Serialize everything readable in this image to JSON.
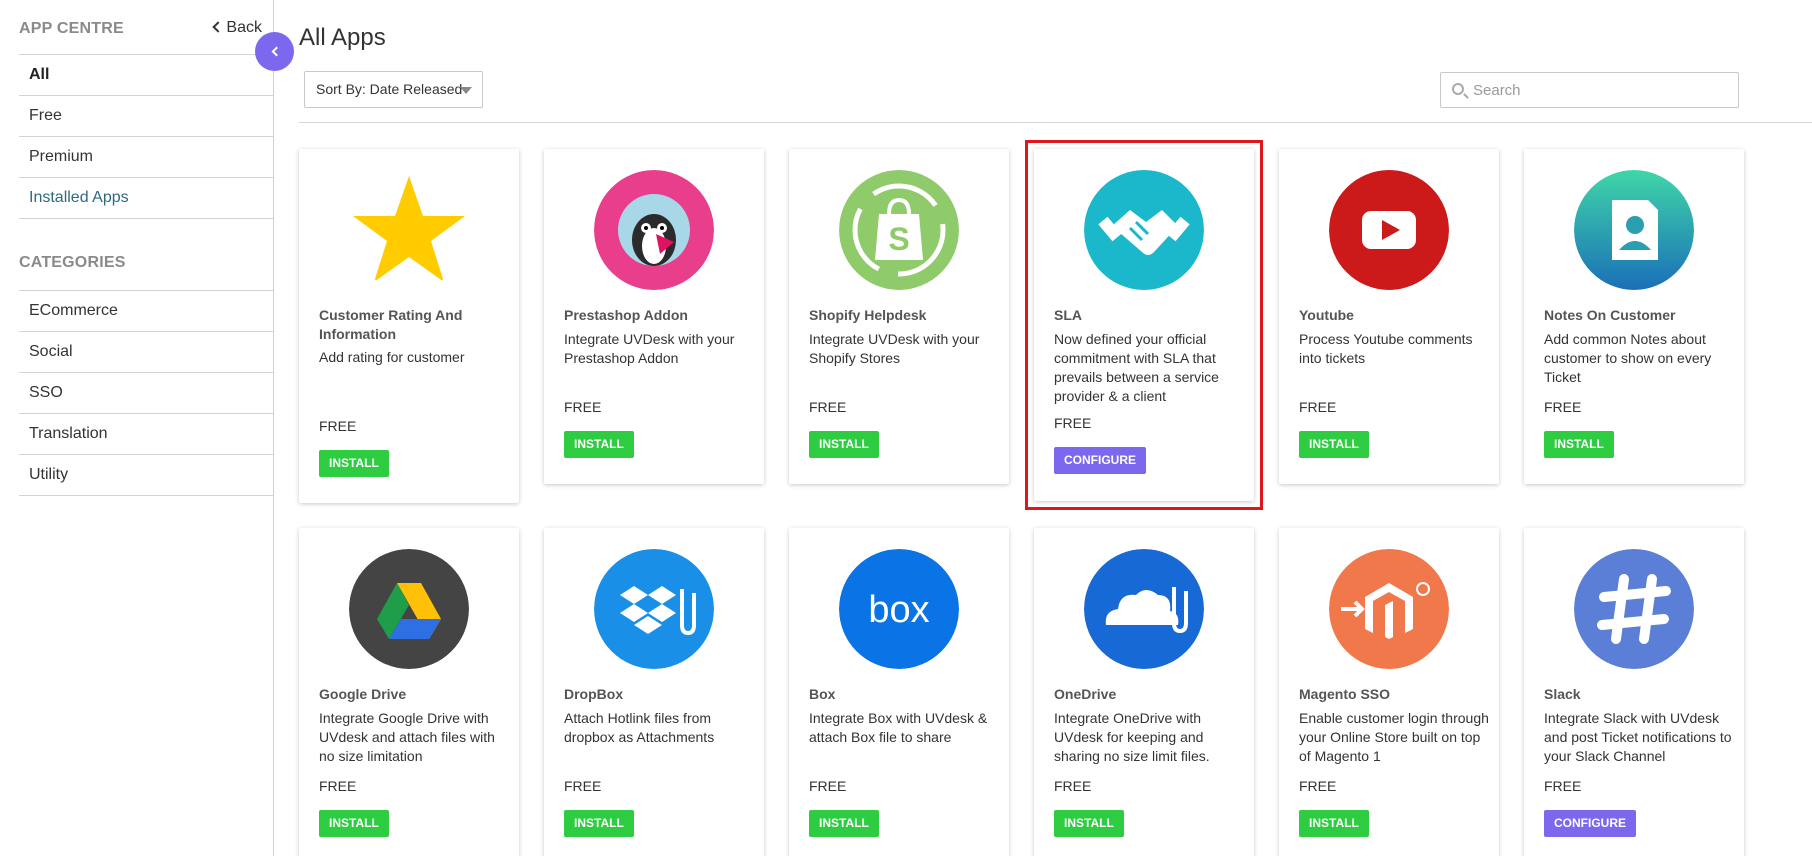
{
  "sidebar": {
    "title": "APP CENTRE",
    "back_label": "Back",
    "items": [
      "All",
      "Free",
      "Premium",
      "Installed Apps"
    ],
    "categories_title": "CATEGORIES",
    "categories": [
      "ECommerce",
      "Social",
      "SSO",
      "Translation",
      "Utility"
    ]
  },
  "main": {
    "title": "All Apps",
    "sort_label": "Sort By: Date Released",
    "search_placeholder": "Search"
  },
  "apps": [
    {
      "name": "Customer Rating And Information",
      "desc": "Add rating for customer",
      "price": "FREE",
      "action": "INSTALL",
      "icon": "star-icon"
    },
    {
      "name": "Prestashop Addon",
      "desc": "Integrate UVDesk with your Prestashop Addon",
      "price": "FREE",
      "action": "INSTALL",
      "icon": "prestashop-icon"
    },
    {
      "name": "Shopify Helpdesk",
      "desc": "Integrate UVDesk with your Shopify Stores",
      "price": "FREE",
      "action": "INSTALL",
      "icon": "shopify-icon"
    },
    {
      "name": "SLA",
      "desc": "Now defined your official commitment with SLA that prevails between a service provider & a client",
      "price": "FREE",
      "action": "CONFIGURE",
      "icon": "handshake-icon"
    },
    {
      "name": "Youtube",
      "desc": "Process Youtube comments into tickets",
      "price": "FREE",
      "action": "INSTALL",
      "icon": "youtube-icon"
    },
    {
      "name": "Notes On Customer",
      "desc": "Add common Notes about customer to show on every Ticket",
      "price": "FREE",
      "action": "INSTALL",
      "icon": "notes-icon"
    },
    {
      "name": "Google Drive",
      "desc": "Integrate Google Drive with UVdesk and attach files with no size limitation",
      "price": "FREE",
      "action": "INSTALL",
      "icon": "google-drive-icon"
    },
    {
      "name": "DropBox",
      "desc": "Attach Hotlink files from dropbox as Attachments",
      "price": "FREE",
      "action": "INSTALL",
      "icon": "dropbox-icon"
    },
    {
      "name": "Box",
      "desc": "Integrate Box with UVdesk & attach Box file to share",
      "price": "FREE",
      "action": "INSTALL",
      "icon": "box-icon"
    },
    {
      "name": "OneDrive",
      "desc": "Integrate OneDrive with UVdesk for keeping and sharing no size limit files.",
      "price": "FREE",
      "action": "INSTALL",
      "icon": "onedrive-icon"
    },
    {
      "name": "Magento SSO",
      "desc": "Enable customer login through your Online Store built on top of Magento 1",
      "price": "FREE",
      "action": "INSTALL",
      "icon": "magento-icon"
    },
    {
      "name": "Slack",
      "desc": "Integrate Slack with UVdesk and post Ticket notifications to your Slack Channel",
      "price": "FREE",
      "action": "CONFIGURE",
      "icon": "slack-icon"
    }
  ],
  "colors": {
    "accent": "#7b68ee",
    "install": "#2ecc40",
    "highlight": "#e0151d"
  }
}
